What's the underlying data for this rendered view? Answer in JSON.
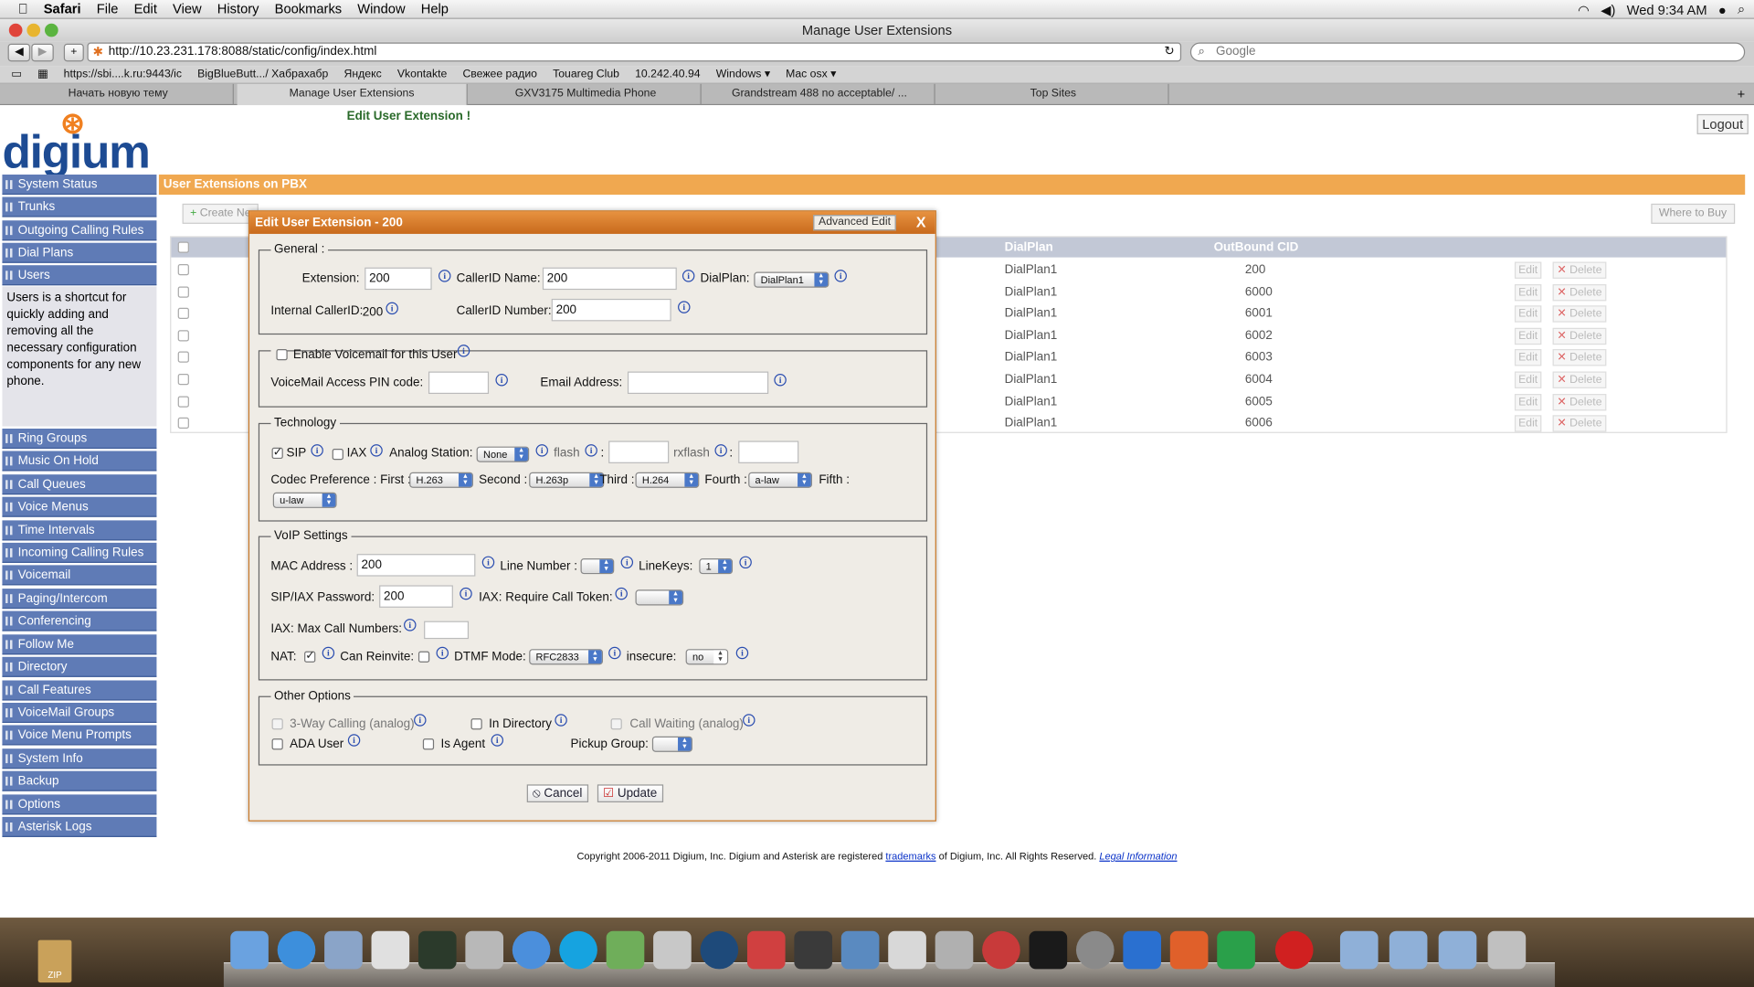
{
  "menubar": {
    "apple": "",
    "app": "Safari",
    "items": [
      "File",
      "Edit",
      "View",
      "History",
      "Bookmarks",
      "Window",
      "Help"
    ],
    "clock": "Wed 9:34 AM"
  },
  "window": {
    "title": "Manage User Extensions"
  },
  "toolbar": {
    "url": "http://10.23.231.178:8088/static/config/index.html",
    "search_placeholder": "Google"
  },
  "bookmarks": [
    "https://sbi....k.ru:9443/ic",
    "BigBlueButt.../ Хабрахабр",
    "Яндекс",
    "Vkontakte",
    "Свежее радио",
    "Touareg Club",
    "10.242.40.94",
    "Windows ▾",
    "Mac osx ▾"
  ],
  "tabs": [
    "Начать новую тему",
    "Manage User Extensions",
    "GXV3175 Multimedia Phone",
    "Grandstream 488 no acceptable/ ...",
    "Top Sites"
  ],
  "header": {
    "logo": "digium",
    "edit_message": "Edit User Extension !",
    "logout": "Logout"
  },
  "sidebar": {
    "top_items": [
      "System Status",
      "Trunks",
      "Outgoing Calling Rules",
      "Dial Plans",
      "Users"
    ],
    "users_info": "Users is a shortcut for quickly adding and removing all the necessary configuration components for any new phone.",
    "bottom_items": [
      "Ring Groups",
      "Music On Hold",
      "Call Queues",
      "Voice Menus",
      "Time Intervals",
      "Incoming Calling Rules",
      "Voicemail",
      "Paging/Intercom",
      "Conferencing",
      "Follow Me",
      "Directory",
      "Call Features",
      "VoiceMail Groups",
      "Voice Menu Prompts",
      "System Info",
      "Backup",
      "Options",
      "Asterisk Logs"
    ]
  },
  "content": {
    "title": "User Extensions on PBX",
    "create_btn": "Create Ne",
    "where_to_buy": "Where to Buy",
    "columns": {
      "dialplan": "DialPlan",
      "outbound": "OutBound CID"
    },
    "rows": [
      {
        "dialplan": "DialPlan1",
        "cid": "200"
      },
      {
        "dialplan": "DialPlan1",
        "cid": "6000"
      },
      {
        "dialplan": "DialPlan1",
        "cid": "6001"
      },
      {
        "dialplan": "DialPlan1",
        "cid": "6002"
      },
      {
        "dialplan": "DialPlan1",
        "cid": "6003"
      },
      {
        "dialplan": "DialPlan1",
        "cid": "6004"
      },
      {
        "dialplan": "DialPlan1",
        "cid": "6005"
      },
      {
        "dialplan": "DialPlan1",
        "cid": "6006"
      }
    ],
    "edit": "Edit",
    "delete": "Delete"
  },
  "dialog": {
    "title": "Edit User Extension - 200",
    "advanced": "Advanced Edit",
    "close": "X",
    "general": {
      "legend": "General :",
      "extension_label": "Extension:",
      "extension": "200",
      "callerid_name_label": "CallerID Name:",
      "callerid_name": "200",
      "dialplan_label": "DialPlan:",
      "dialplan": "DialPlan1",
      "internal_cid_label": "Internal CallerID:",
      "internal_cid": "200",
      "callerid_number_label": "CallerID Number:",
      "callerid_number": "200"
    },
    "voicemail": {
      "enable_label": "Enable Voicemail for this User",
      "pin_label": "VoiceMail Access PIN code:",
      "pin": "",
      "email_label": "Email Address:",
      "email": ""
    },
    "technology": {
      "legend": "Technology",
      "sip": "SIP",
      "iax": "IAX",
      "analog_label": "Analog Station:",
      "analog": "None",
      "flash_label": "flash",
      "colon": ":",
      "rxflash_label": "rxflash",
      "codec_label": "Codec Preference : First :",
      "first": "H.263",
      "second_label": "Second :",
      "second": "H.263p",
      "third_label": "Third :",
      "third": "H.264",
      "fourth_label": "Fourth :",
      "fourth": "a-law",
      "fifth_label": "Fifth :",
      "fifth": "u-law"
    },
    "voip": {
      "legend": "VoIP Settings",
      "mac_label": "MAC Address :",
      "mac": "200",
      "line_label": "Line Number :",
      "linekeys_label": "LineKeys:",
      "linekeys": "1",
      "password_label": "SIP/IAX Password:",
      "password": "200",
      "token_label": "IAX: Require Call Token:",
      "max_label": "IAX: Max Call Numbers:",
      "nat_label": "NAT:",
      "reinvite_label": "Can Reinvite:",
      "dtmf_label": "DTMF Mode:",
      "dtmf": "RFC2833",
      "insecure_label": "insecure:",
      "insecure": "no"
    },
    "other": {
      "legend": "Other Options",
      "three_way": "3-Way Calling (analog)",
      "in_directory": "In Directory",
      "call_waiting": "Call Waiting (analog)",
      "ada": "ADA User",
      "is_agent": "Is Agent",
      "pickup_label": "Pickup Group:"
    },
    "cancel": "Cancel",
    "update": "Update"
  },
  "footer": {
    "pre": "Copyright 2006-2011 Digium, Inc. Digium and Asterisk are registered ",
    "link1": "trademarks",
    "mid": " of Digium, Inc. All Rights Reserved. ",
    "link2": "Legal Information"
  },
  "dock": {
    "zip": "ZIP"
  }
}
